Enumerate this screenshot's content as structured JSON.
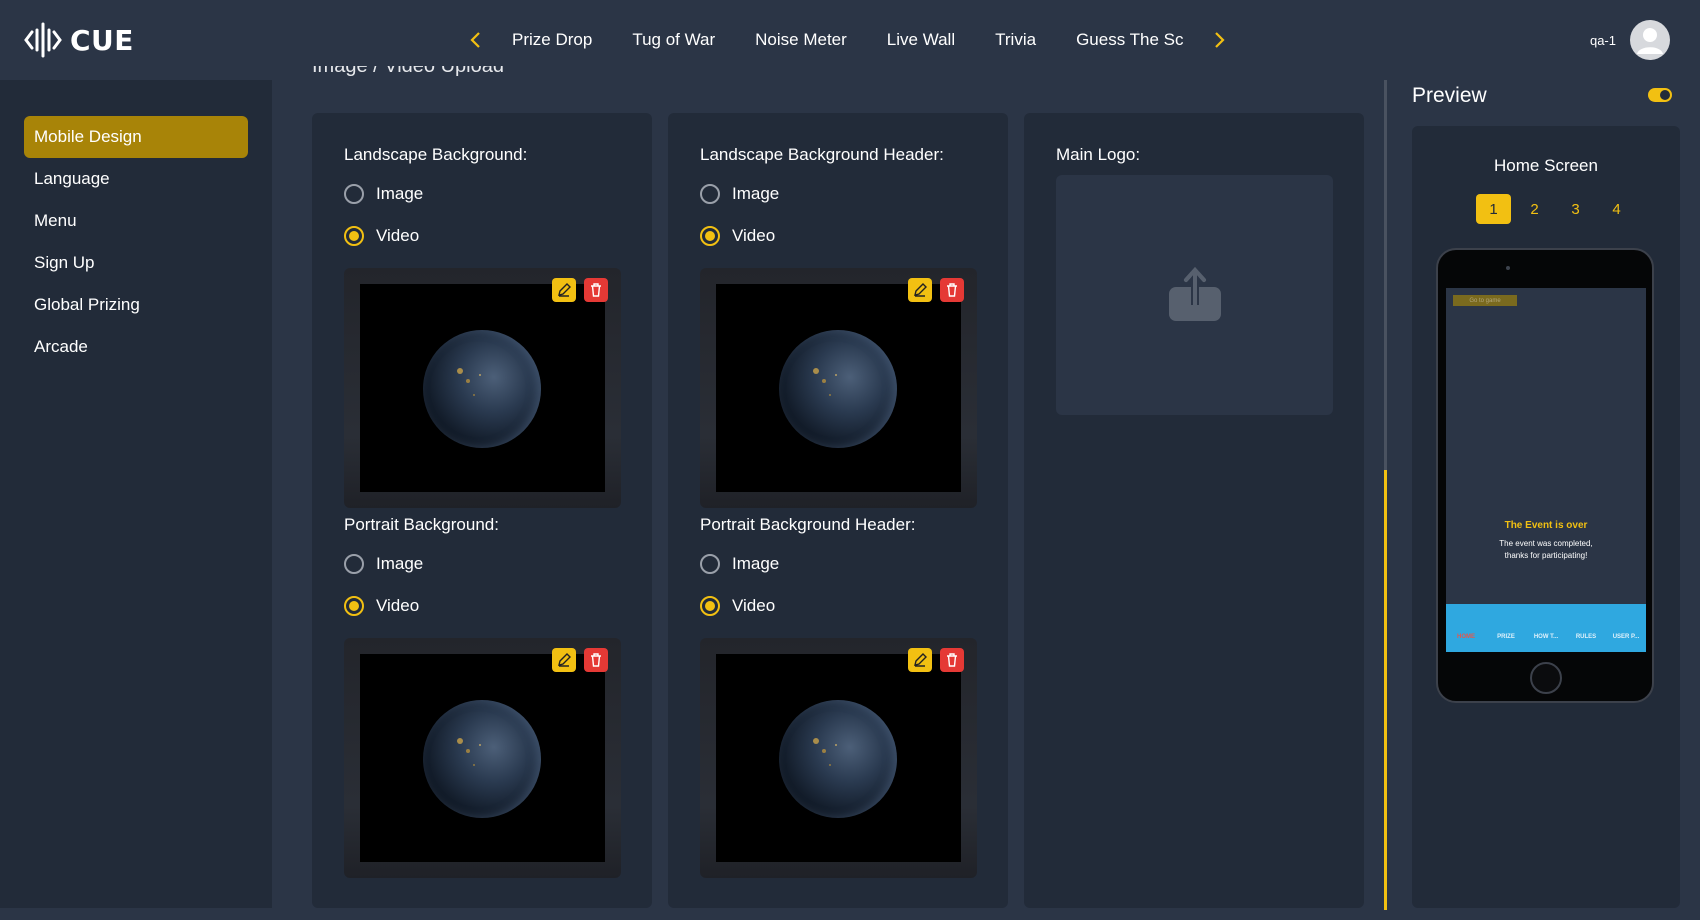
{
  "app": {
    "logo_text": "CUE"
  },
  "nav": {
    "items": [
      "Prize Drop",
      "Tug of War",
      "Noise Meter",
      "Live Wall",
      "Trivia",
      "Guess The Sc"
    ]
  },
  "user": {
    "name": "qa-1"
  },
  "sidebar": {
    "items": [
      {
        "label": "Mobile Design",
        "active": true
      },
      {
        "label": "Language"
      },
      {
        "label": "Menu"
      },
      {
        "label": "Sign Up"
      },
      {
        "label": "Global Prizing"
      },
      {
        "label": "Arcade"
      }
    ]
  },
  "main": {
    "section_title": "Image / Video Upload",
    "options": {
      "image": "Image",
      "video": "Video"
    },
    "fields": {
      "landscape_bg": {
        "label": "Landscape Background:",
        "selected": "Video"
      },
      "portrait_bg": {
        "label": "Portrait Background:",
        "selected": "Video"
      },
      "landscape_header": {
        "label": "Landscape Background Header:",
        "selected": "Video"
      },
      "portrait_header": {
        "label": "Portrait Background Header:",
        "selected": "Video"
      },
      "main_logo": {
        "label": "Main Logo:"
      }
    }
  },
  "preview": {
    "title": "Preview",
    "toggle_on": true,
    "screen_label": "Home Screen",
    "pages": [
      "1",
      "2",
      "3",
      "4"
    ],
    "active_page": "1",
    "phone": {
      "go_button": "Go to game",
      "event_title": "The Event is over",
      "event_text_1": "The event was completed,",
      "event_text_2": "thanks for participating!",
      "tabs": [
        "HOME",
        "PRIZE",
        "HOW T...",
        "RULES",
        "USER P..."
      ]
    }
  },
  "colors": {
    "accent": "#f2c012",
    "delete": "#e53935",
    "sidebar_active": "#a88408",
    "tabbar": "#2fa8e0"
  }
}
